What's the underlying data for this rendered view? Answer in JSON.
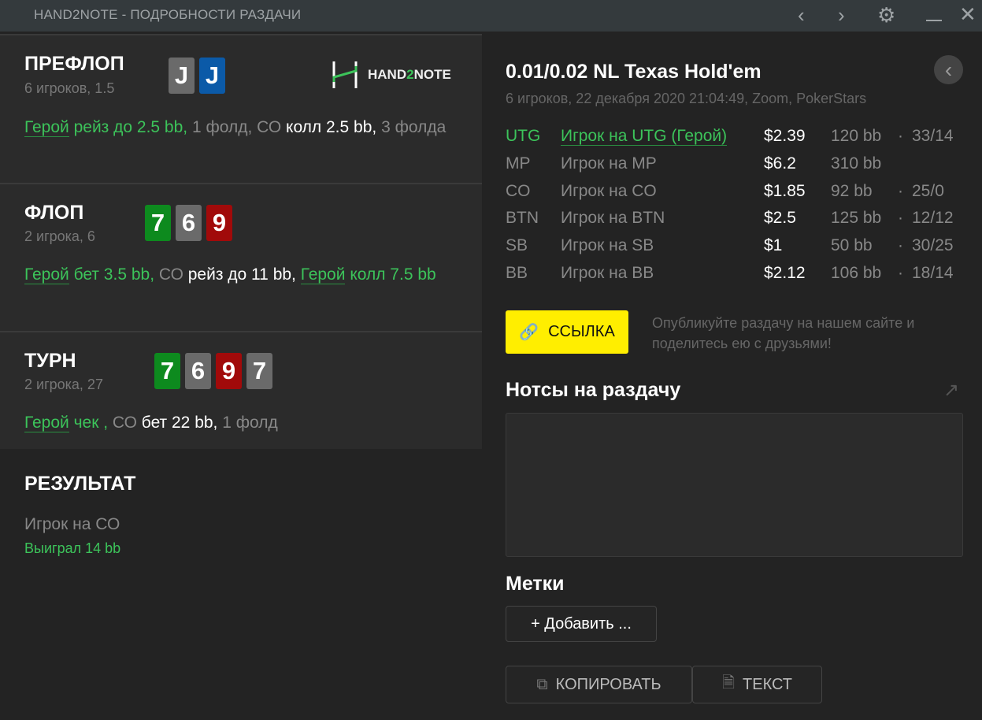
{
  "window": {
    "title": "HAND2NOTE - ПОДРОБНОСТИ РАЗДАЧИ",
    "icons": [
      "chevron-left-icon",
      "chevron-right-icon",
      "gear-icon",
      "minimize-icon",
      "close-icon"
    ]
  },
  "logo": {
    "text": "HAND2NOTE"
  },
  "streets": [
    {
      "name": "ПРЕФЛОП",
      "sub": "6 игроков, 1.5",
      "cards": [
        {
          "rank": "J",
          "color": "#6a6a6a"
        },
        {
          "rank": "J",
          "color": "#0b5aa8"
        }
      ],
      "actions": [
        {
          "t": "Герой",
          "c": "g",
          "u": true
        },
        {
          "t": " рейз до 2.5 bb,",
          "c": "g"
        },
        {
          "t": " 1 фолд, СО",
          "c": "m"
        },
        {
          "t": " колл 2.5 bb,",
          "c": "w"
        },
        {
          "t": " 3 фолда",
          "c": "m"
        }
      ]
    },
    {
      "name": "ФЛОП",
      "sub": "2 игрока, 6",
      "cards": [
        {
          "rank": "7",
          "color": "#0d8a1e"
        },
        {
          "rank": "6",
          "color": "#6a6a6a"
        },
        {
          "rank": "9",
          "color": "#a10a0a"
        }
      ],
      "actions": [
        {
          "t": "Герой",
          "c": "g",
          "u": true
        },
        {
          "t": " бет 3.5 bb,",
          "c": "g"
        },
        {
          "t": " СО",
          "c": "m"
        },
        {
          "t": " рейз до 11 bb, ",
          "c": "w"
        },
        {
          "t": "Герой",
          "c": "g",
          "u": true
        },
        {
          "t": " колл 7.5 bb",
          "c": "g"
        }
      ]
    },
    {
      "name": "ТУРН",
      "sub": "2 игрока, 27",
      "cards": [
        {
          "rank": "7",
          "color": "#0d8a1e"
        },
        {
          "rank": "6",
          "color": "#6a6a6a"
        },
        {
          "rank": "9",
          "color": "#a10a0a"
        },
        {
          "rank": "7",
          "color": "#6a6a6a"
        }
      ],
      "actions": [
        {
          "t": "Герой",
          "c": "g",
          "u": true
        },
        {
          "t": " чек ,",
          "c": "g"
        },
        {
          "t": " СО",
          "c": "m"
        },
        {
          "t": " бет 22 bb,",
          "c": "w"
        },
        {
          "t": " 1 фолд",
          "c": "m"
        }
      ]
    }
  ],
  "result": {
    "title": "РЕЗУЛЬТАТ",
    "player": "Игрок на СО",
    "won": "Выиграл 14 bb"
  },
  "hand": {
    "title": "0.01/0.02 NL Texas Hold'em",
    "sub": "6 игроков, 22 декабря 2020 21:04:49, Zoom, PokerStars"
  },
  "players": [
    {
      "pos": "UTG",
      "name": "Игрок на UTG (Герой)",
      "stack": "$2.39",
      "bb": "120 bb",
      "stat": "33/14",
      "hero": true
    },
    {
      "pos": "MP",
      "name": "Игрок на MP",
      "stack": "$6.2",
      "bb": "310 bb",
      "stat": ""
    },
    {
      "pos": "CO",
      "name": "Игрок на CO",
      "stack": "$1.85",
      "bb": "92 bb",
      "stat": "25/0"
    },
    {
      "pos": "BTN",
      "name": "Игрок на BTN",
      "stack": "$2.5",
      "bb": "125 bb",
      "stat": "12/12"
    },
    {
      "pos": "SB",
      "name": "Игрок на SB",
      "stack": "$1",
      "bb": "50 bb",
      "stat": "30/25"
    },
    {
      "pos": "BB",
      "name": "Игрок на BB",
      "stack": "$2.12",
      "bb": "106 bb",
      "stat": "18/14"
    }
  ],
  "link": {
    "label": "ССЫЛКА",
    "hint": "Опубликуйте раздачу на нашем сайте и поделитесь ею с друзьями!",
    "color": "#ffee00"
  },
  "notes": {
    "title": "Нотсы на раздачу",
    "value": ""
  },
  "tags": {
    "title": "Метки",
    "add_label": "+  Добавить ..."
  },
  "buttons": {
    "copy": "КОПИРОВАТЬ",
    "text": "ТЕКСТ"
  }
}
